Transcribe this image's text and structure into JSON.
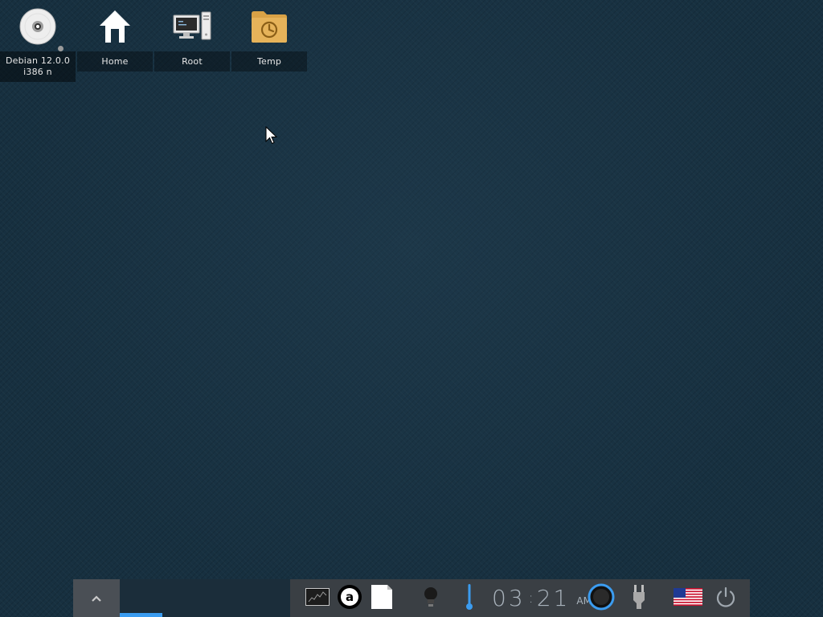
{
  "desktop": {
    "icons": [
      {
        "label_line1": "Debian 12.0.0",
        "label_line2": "i386 n"
      },
      {
        "label": "Home"
      },
      {
        "label": "Root"
      },
      {
        "label": "Temp"
      }
    ]
  },
  "taskbar": {
    "clock": {
      "hours": "03",
      "minutes": "21",
      "ampm": "AM"
    },
    "tray_icons": [
      "terminal-icon",
      "a-circle-app-icon",
      "document-icon",
      "lightbulb-icon",
      "temperature-icon",
      "circle-status-icon",
      "network-plug-icon",
      "us-flag-icon",
      "power-icon"
    ],
    "colors": {
      "accent": "#3b9cf0",
      "panel": "#3a3f44"
    }
  }
}
